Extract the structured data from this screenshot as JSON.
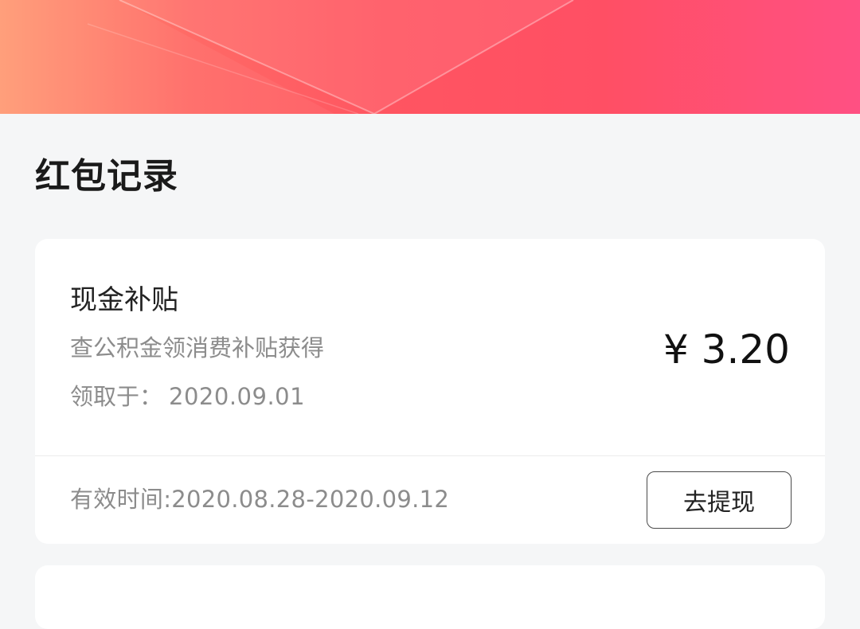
{
  "colors": {
    "banner_gradient_start": "#ff9a74",
    "banner_gradient_end": "#ff5083",
    "page_background": "#f5f6f7",
    "card_background": "#ffffff"
  },
  "section": {
    "title": "红包记录"
  },
  "record": {
    "title": "现金补贴",
    "description": "查公积金领消费补贴获得",
    "received_label": "领取于：",
    "received_date": "2020.09.01",
    "amount": "¥ 3.20",
    "validity": "有效时间:2020.08.28-2020.09.12",
    "withdraw_label": "去提现"
  }
}
